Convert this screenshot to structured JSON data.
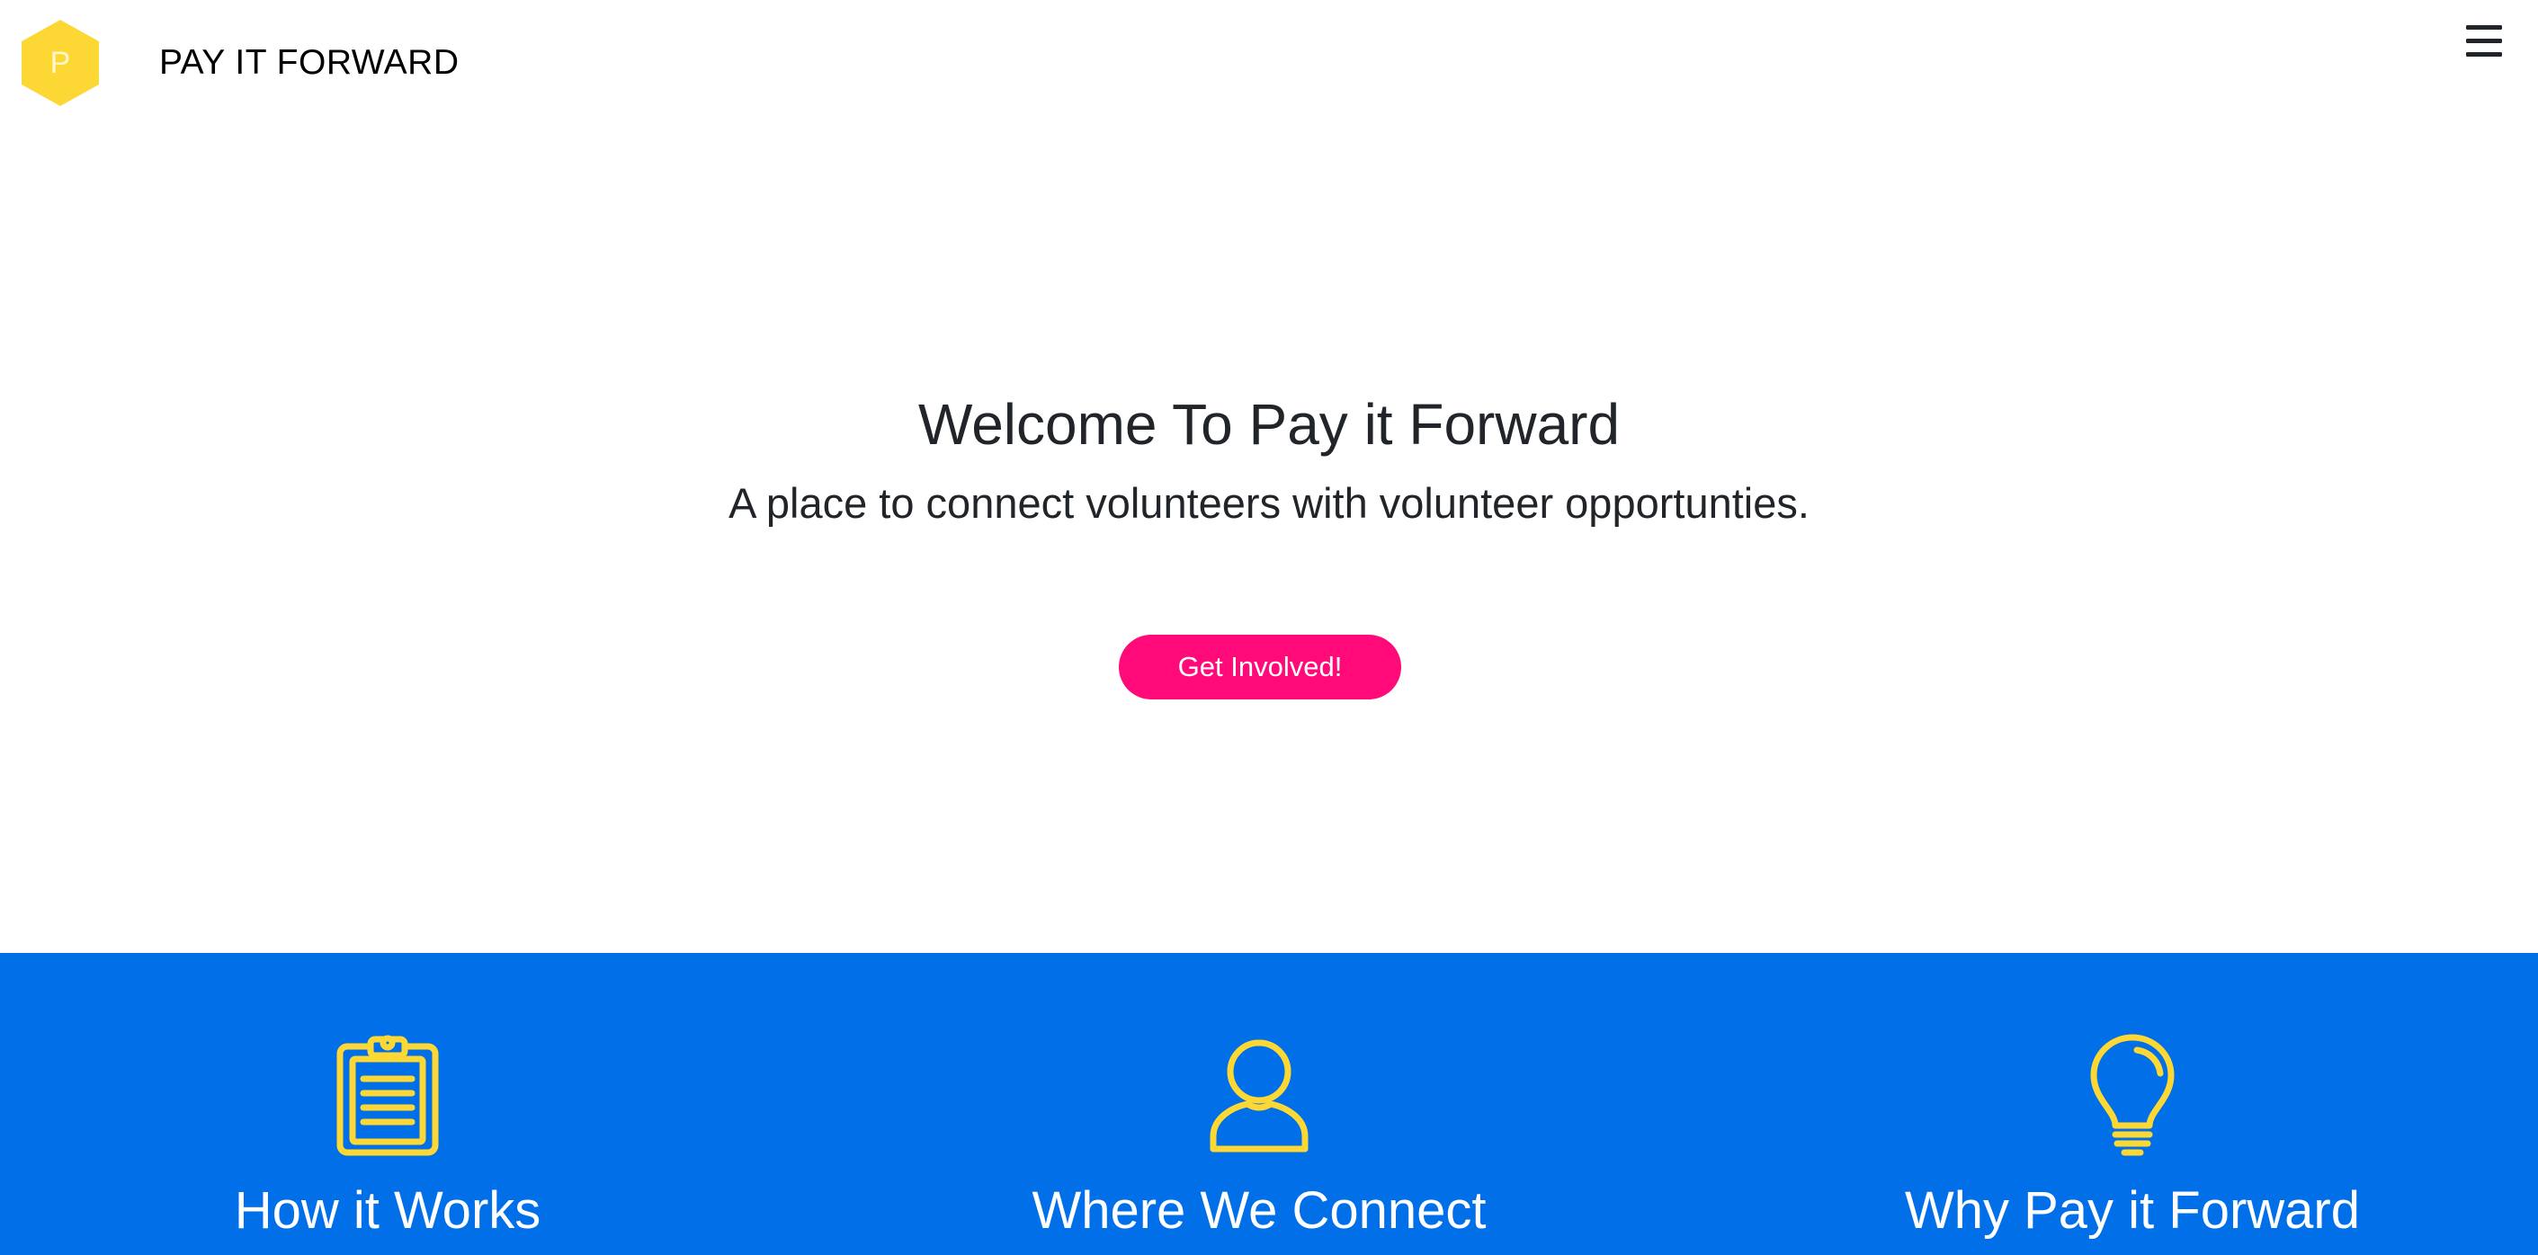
{
  "colors": {
    "accent_yellow": "#fdd835",
    "cta_pink": "#ff0a78",
    "feature_band_blue": "#006fe8",
    "text_dark": "#212529"
  },
  "nav": {
    "logo_letter": "P",
    "brand_name": "PAY IT FORWARD",
    "logo_icon": "hexagon-logo-icon",
    "menu_icon": "hamburger-menu-icon"
  },
  "hero": {
    "title": "Welcome To Pay it Forward",
    "subtitle": "A place to connect volunteers with volunteer opportunties.",
    "cta_label": "Get Involved!"
  },
  "features": [
    {
      "title": "How it Works",
      "icon": "clipboard-icon"
    },
    {
      "title": "Where We Connect",
      "icon": "user-icon"
    },
    {
      "title": "Why Pay it Forward",
      "icon": "lightbulb-icon"
    }
  ]
}
